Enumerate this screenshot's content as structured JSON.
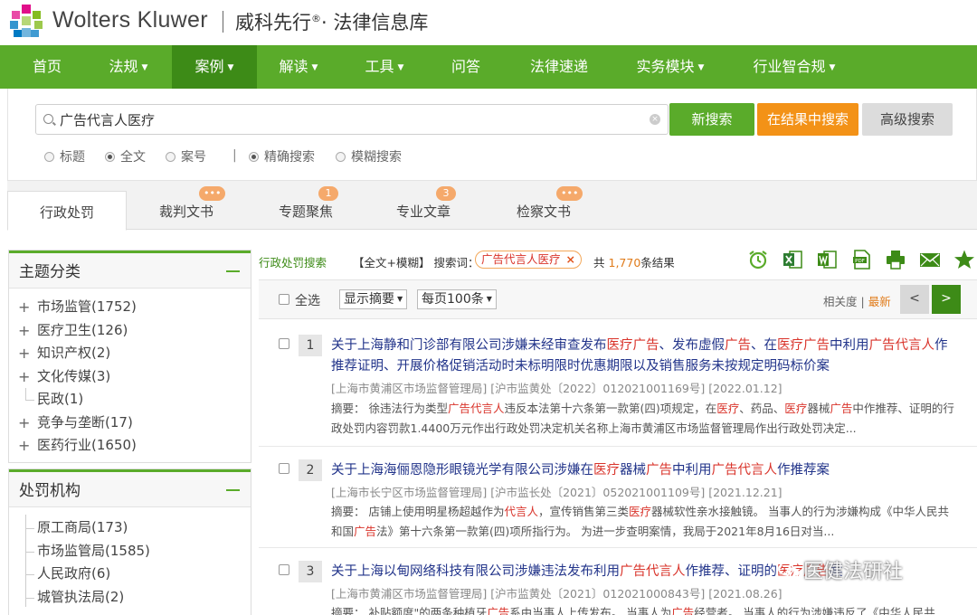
{
  "header": {
    "brand": "Wolters Kluwer",
    "brand_cn_main": "威科先行",
    "brand_cn_reg": "®",
    "brand_cn_sub": "· 法律信息库",
    "logo_colors": [
      "#e10e8a",
      "#85bc20",
      "#007ac3"
    ]
  },
  "nav": {
    "items": [
      {
        "label": "首页",
        "dropdown": false
      },
      {
        "label": "法规",
        "dropdown": true
      },
      {
        "label": "案例",
        "dropdown": true,
        "active": true
      },
      {
        "label": "解读",
        "dropdown": true
      },
      {
        "label": "工具",
        "dropdown": true
      },
      {
        "label": "问答",
        "dropdown": false
      },
      {
        "label": "法律速递",
        "dropdown": false
      },
      {
        "label": "实务模块",
        "dropdown": true
      },
      {
        "label": "行业智合规",
        "dropdown": true
      }
    ],
    "caret": "▼"
  },
  "search": {
    "value": "广告代言人医疗",
    "clear": "×",
    "btn_new": "新搜索",
    "btn_within": "在结果中搜索",
    "btn_advanced": "高级搜索",
    "scope": [
      "标题",
      "全文",
      "案号"
    ],
    "scope_selected": "全文",
    "separator": "|",
    "match": [
      "精确搜索",
      "模糊搜索"
    ],
    "match_selected": "精确搜索"
  },
  "tabs": [
    {
      "label": "行政处罚",
      "badge": "",
      "active": true
    },
    {
      "label": "裁判文书",
      "badge": "•••"
    },
    {
      "label": "专题聚焦",
      "badge": "1"
    },
    {
      "label": "专业文章",
      "badge": "3"
    },
    {
      "label": "检察文书",
      "badge": "•••"
    }
  ],
  "sidebar": {
    "topic": {
      "title": "主题分类",
      "items": [
        {
          "label": "市场监管(1752)",
          "expandable": true
        },
        {
          "label": "医疗卫生(126)",
          "expandable": true
        },
        {
          "label": "知识产权(2)",
          "expandable": true
        },
        {
          "label": "文化传媒(3)",
          "expandable": true
        },
        {
          "label": "民政(1)",
          "expandable": false
        },
        {
          "label": "竞争与垄断(17)",
          "expandable": true
        },
        {
          "label": "医药行业(1650)",
          "expandable": true
        }
      ]
    },
    "agency": {
      "title": "处罚机构",
      "items": [
        {
          "label": "原工商局(173)"
        },
        {
          "label": "市场监管局(1585)"
        },
        {
          "label": "人民政府(6)"
        },
        {
          "label": "城管执法局(2)"
        }
      ]
    },
    "plus": "+"
  },
  "results_header": {
    "link": "行政处罚搜索",
    "mode": "【全文+模糊】 搜索词：",
    "keyword": "广告代言人医疗",
    "keyword_remove": "×",
    "count_prefix": "共",
    "count": "1,770",
    "count_suffix": "条结果",
    "tools": [
      "alarm-icon",
      "excel-icon",
      "word-icon",
      "pdf-icon",
      "print-icon",
      "mail-icon",
      "star-icon"
    ]
  },
  "list_toolbar": {
    "select_all": "全选",
    "display": "显示摘要",
    "per_page": "每页100条",
    "sort_relevance": "相关度",
    "sort_sep": "|",
    "sort_newest": "最新",
    "prev": "<",
    "next": ">"
  },
  "results": [
    {
      "index": "1",
      "title_parts": [
        {
          "t": "关于上海静和门诊部有限公司涉嫌未经审查发布"
        },
        {
          "t": "医疗",
          "h": true
        },
        {
          "t": "广告",
          "h": true
        },
        {
          "t": "、发布虚假"
        },
        {
          "t": "广告",
          "h": true
        },
        {
          "t": "、在"
        },
        {
          "t": "医疗",
          "h": true
        },
        {
          "t": "广告",
          "h": true
        },
        {
          "t": "中利用"
        },
        {
          "t": "广告代言人",
          "h": true
        },
        {
          "t": "作推荐证明、开展价格促销活动时未标明限时优惠期限以及销售服务未按规定明码标价案"
        }
      ],
      "meta": "[上海市黄浦区市场监督管理局] [沪市监黄处〔2022〕012021001169号] [2022.01.12]",
      "abstract_parts": [
        {
          "t": "摘要：   徐违法行为类型"
        },
        {
          "t": "广告代言人",
          "h": true
        },
        {
          "t": "违反本法第十六条第一款第(四)项规定，在"
        },
        {
          "t": "医疗",
          "h": true
        },
        {
          "t": "、药品、"
        },
        {
          "t": "医疗",
          "h": true
        },
        {
          "t": "器械"
        },
        {
          "t": "广告",
          "h": true
        },
        {
          "t": "中作推荐、证明的行政处罚内容罚款1.4400万元作出行政处罚决定机关名称上海市黄浦区市场监督管理局作出行政处罚决定..."
        }
      ]
    },
    {
      "index": "2",
      "title_parts": [
        {
          "t": "关于上海海俪恩隐形眼镜光学有限公司涉嫌在"
        },
        {
          "t": "医疗",
          "h": true
        },
        {
          "t": "器械"
        },
        {
          "t": "广告",
          "h": true
        },
        {
          "t": "中利用"
        },
        {
          "t": "广告代言人",
          "h": true
        },
        {
          "t": "作推荐案"
        }
      ],
      "meta": "[上海市长宁区市场监督管理局] [沪市监长处〔2021〕052021001109号] [2021.12.21]",
      "abstract_parts": [
        {
          "t": "摘要：   店铺上使用明星杨超越作为"
        },
        {
          "t": "代言人",
          "h": true
        },
        {
          "t": "，宣传销售第三类"
        },
        {
          "t": "医疗",
          "h": true
        },
        {
          "t": "器械软性亲水接触镜。 当事人的行为涉嫌构成《中华人民共和国"
        },
        {
          "t": "广告",
          "h": true
        },
        {
          "t": "法》第十六条第一款第(四)项所指行为。 为进一步查明案情，我局于2021年8月16日对当..."
        }
      ]
    },
    {
      "index": "3",
      "title_parts": [
        {
          "t": "关于上海以甸网络科技有限公司涉嫌违法发布利用"
        },
        {
          "t": "广告代言人",
          "h": true
        },
        {
          "t": "作推荐、证明的"
        },
        {
          "t": "医疗",
          "h": true
        },
        {
          "t": "广告",
          "h": true
        },
        {
          "t": "案"
        }
      ],
      "meta": "[上海市黄浦区市场监督管理局] [沪市监黄处〔2021〕012021000843号] [2021.08.26]",
      "abstract_parts": [
        {
          "t": "摘要：   补贴额度\"的两条种植牙"
        },
        {
          "t": "广告",
          "h": true
        },
        {
          "t": "系由当事人上传发布。 当事人为"
        },
        {
          "t": "广告",
          "h": true
        },
        {
          "t": "经营者。 当事人的行为涉嫌违反了《中华人民共"
        }
      ]
    }
  ],
  "watermark": "医健法研社"
}
